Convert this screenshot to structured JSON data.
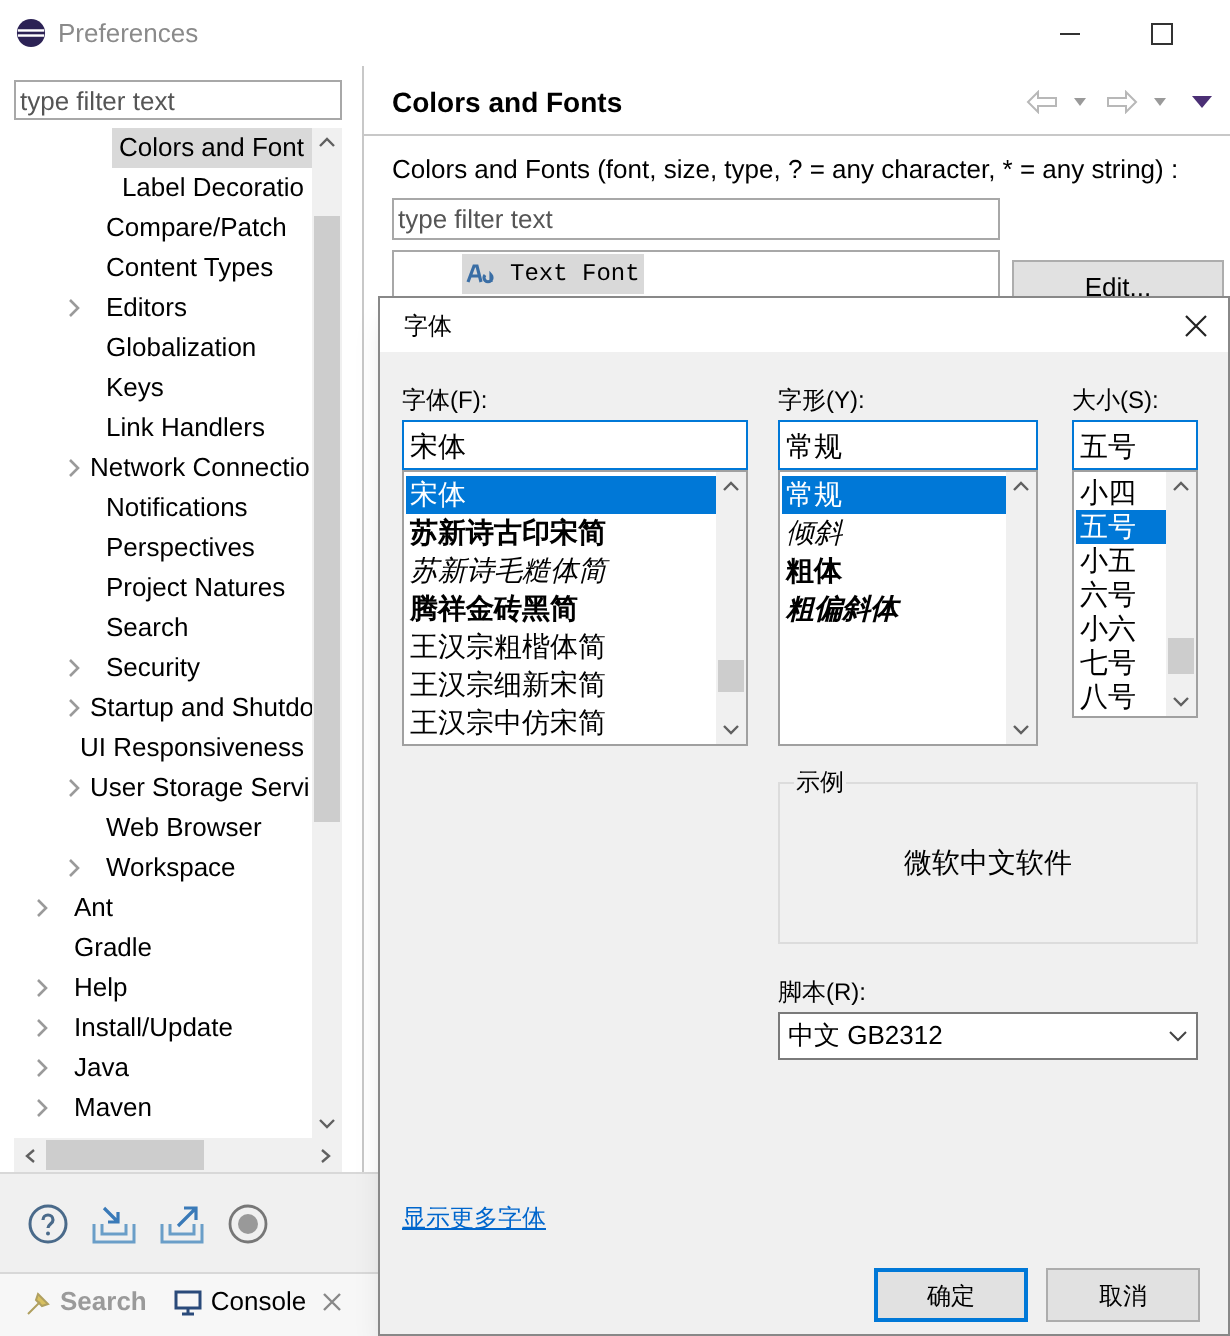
{
  "window": {
    "title": "Preferences"
  },
  "sidebar": {
    "filter": {
      "placeholder": "type filter text"
    },
    "tree": [
      {
        "children": [
          {
            "children": [
              {
                "label": "Colors and Font",
                "expandable": false,
                "selected": true
              },
              {
                "label": "Label Decoratio",
                "expandable": false,
                "selected": false
              }
            ]
          },
          {
            "label": "Compare/Patch",
            "expandable": false,
            "selected": false
          },
          {
            "label": "Content Types",
            "expandable": false,
            "selected": false
          },
          {
            "label": "Editors",
            "expandable": true,
            "selected": false
          },
          {
            "label": "Globalization",
            "expandable": false,
            "selected": false
          },
          {
            "label": "Keys",
            "expandable": false,
            "selected": false
          },
          {
            "label": "Link Handlers",
            "expandable": false,
            "selected": false
          },
          {
            "label": "Network Connectio",
            "expandable": true,
            "selected": false
          },
          {
            "label": "Notifications",
            "expandable": false,
            "selected": false
          },
          {
            "label": "Perspectives",
            "expandable": false,
            "selected": false
          },
          {
            "label": "Project Natures",
            "expandable": false,
            "selected": false
          },
          {
            "label": "Search",
            "expandable": false,
            "selected": false
          },
          {
            "label": "Security",
            "expandable": true,
            "selected": false
          },
          {
            "label": "Startup and Shutdo",
            "expandable": true,
            "selected": false
          },
          {
            "label": "UI Responsiveness",
            "expandable": false,
            "selected": false
          },
          {
            "label": "User Storage Servi",
            "expandable": true,
            "selected": false
          },
          {
            "label": "Web Browser",
            "expandable": false,
            "selected": false
          },
          {
            "label": "Workspace",
            "expandable": true,
            "selected": false
          }
        ]
      },
      {
        "label": "Ant",
        "expandable": true,
        "selected": false
      },
      {
        "label": "Gradle",
        "expandable": false,
        "selected": false
      },
      {
        "label": "Help",
        "expandable": true,
        "selected": false
      },
      {
        "label": "Install/Update",
        "expandable": true,
        "selected": false
      },
      {
        "label": "Java",
        "expandable": true,
        "selected": false
      },
      {
        "label": "Maven",
        "expandable": true,
        "selected": false
      }
    ]
  },
  "page": {
    "title": "Colors and Fonts",
    "description": "Colors and Fonts (font, size, type, ? = any character, * = any string) :",
    "filter": {
      "placeholder": "type filter text"
    },
    "items": [
      {
        "label": "Text Font",
        "selected": true
      }
    ],
    "edit_button": "Edit..."
  },
  "bottom_tabs": [
    {
      "label": "Search",
      "selected": false,
      "closable": false
    },
    {
      "label": "Console",
      "selected": true,
      "closable": true
    }
  ],
  "dialog": {
    "title": "字体",
    "font": {
      "label": "字体(F):",
      "value": "宋体",
      "options": [
        {
          "label": "宋体",
          "kind": "regular",
          "selected": true
        },
        {
          "label": "苏新诗古印宋简",
          "kind": "bold",
          "selected": false
        },
        {
          "label": "苏新诗毛糙体简",
          "kind": "italic",
          "selected": false
        },
        {
          "label": "腾祥金砖黑简",
          "kind": "bold",
          "selected": false
        },
        {
          "label": "王汉宗粗楷体简",
          "kind": "regular",
          "selected": false
        },
        {
          "label": "王汉宗细新宋简",
          "kind": "regular",
          "selected": false
        },
        {
          "label": "王汉宗中仿宋简",
          "kind": "regular",
          "selected": false
        }
      ]
    },
    "style": {
      "label": "字形(Y):",
      "value": "常规",
      "options": [
        {
          "label": "常规",
          "kind": "regular",
          "selected": true
        },
        {
          "label": "倾斜",
          "kind": "italic",
          "selected": false
        },
        {
          "label": "粗体",
          "kind": "bold",
          "selected": false
        },
        {
          "label": "粗偏斜体",
          "kind": "bolditalic",
          "selected": false
        }
      ]
    },
    "size": {
      "label": "大小(S):",
      "value": "五号",
      "options": [
        {
          "label": "小四",
          "selected": false
        },
        {
          "label": "五号",
          "selected": true
        },
        {
          "label": "小五",
          "selected": false
        },
        {
          "label": "六号",
          "selected": false
        },
        {
          "label": "小六",
          "selected": false
        },
        {
          "label": "七号",
          "selected": false
        },
        {
          "label": "八号",
          "selected": false
        }
      ]
    },
    "sample": {
      "label": "示例",
      "text": "微软中文软件"
    },
    "script": {
      "label": "脚本(R):",
      "value": "中文 GB2312"
    },
    "more_fonts_link": "显示更多字体",
    "buttons": [
      {
        "label": "确定",
        "default": true
      },
      {
        "label": "取消",
        "default": false
      }
    ]
  }
}
